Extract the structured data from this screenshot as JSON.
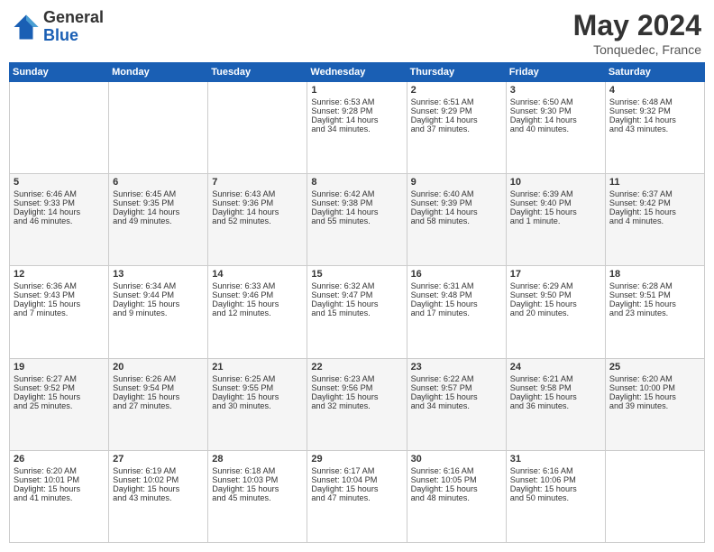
{
  "header": {
    "logo_general": "General",
    "logo_blue": "Blue",
    "month_title": "May 2024",
    "location": "Tonquedec, France"
  },
  "weekdays": [
    "Sunday",
    "Monday",
    "Tuesday",
    "Wednesday",
    "Thursday",
    "Friday",
    "Saturday"
  ],
  "weeks": [
    [
      {
        "day": "",
        "content": ""
      },
      {
        "day": "",
        "content": ""
      },
      {
        "day": "",
        "content": ""
      },
      {
        "day": "1",
        "content": "Sunrise: 6:53 AM\nSunset: 9:28 PM\nDaylight: 14 hours\nand 34 minutes."
      },
      {
        "day": "2",
        "content": "Sunrise: 6:51 AM\nSunset: 9:29 PM\nDaylight: 14 hours\nand 37 minutes."
      },
      {
        "day": "3",
        "content": "Sunrise: 6:50 AM\nSunset: 9:30 PM\nDaylight: 14 hours\nand 40 minutes."
      },
      {
        "day": "4",
        "content": "Sunrise: 6:48 AM\nSunset: 9:32 PM\nDaylight: 14 hours\nand 43 minutes."
      }
    ],
    [
      {
        "day": "5",
        "content": "Sunrise: 6:46 AM\nSunset: 9:33 PM\nDaylight: 14 hours\nand 46 minutes."
      },
      {
        "day": "6",
        "content": "Sunrise: 6:45 AM\nSunset: 9:35 PM\nDaylight: 14 hours\nand 49 minutes."
      },
      {
        "day": "7",
        "content": "Sunrise: 6:43 AM\nSunset: 9:36 PM\nDaylight: 14 hours\nand 52 minutes."
      },
      {
        "day": "8",
        "content": "Sunrise: 6:42 AM\nSunset: 9:38 PM\nDaylight: 14 hours\nand 55 minutes."
      },
      {
        "day": "9",
        "content": "Sunrise: 6:40 AM\nSunset: 9:39 PM\nDaylight: 14 hours\nand 58 minutes."
      },
      {
        "day": "10",
        "content": "Sunrise: 6:39 AM\nSunset: 9:40 PM\nDaylight: 15 hours\nand 1 minute."
      },
      {
        "day": "11",
        "content": "Sunrise: 6:37 AM\nSunset: 9:42 PM\nDaylight: 15 hours\nand 4 minutes."
      }
    ],
    [
      {
        "day": "12",
        "content": "Sunrise: 6:36 AM\nSunset: 9:43 PM\nDaylight: 15 hours\nand 7 minutes."
      },
      {
        "day": "13",
        "content": "Sunrise: 6:34 AM\nSunset: 9:44 PM\nDaylight: 15 hours\nand 9 minutes."
      },
      {
        "day": "14",
        "content": "Sunrise: 6:33 AM\nSunset: 9:46 PM\nDaylight: 15 hours\nand 12 minutes."
      },
      {
        "day": "15",
        "content": "Sunrise: 6:32 AM\nSunset: 9:47 PM\nDaylight: 15 hours\nand 15 minutes."
      },
      {
        "day": "16",
        "content": "Sunrise: 6:31 AM\nSunset: 9:48 PM\nDaylight: 15 hours\nand 17 minutes."
      },
      {
        "day": "17",
        "content": "Sunrise: 6:29 AM\nSunset: 9:50 PM\nDaylight: 15 hours\nand 20 minutes."
      },
      {
        "day": "18",
        "content": "Sunrise: 6:28 AM\nSunset: 9:51 PM\nDaylight: 15 hours\nand 23 minutes."
      }
    ],
    [
      {
        "day": "19",
        "content": "Sunrise: 6:27 AM\nSunset: 9:52 PM\nDaylight: 15 hours\nand 25 minutes."
      },
      {
        "day": "20",
        "content": "Sunrise: 6:26 AM\nSunset: 9:54 PM\nDaylight: 15 hours\nand 27 minutes."
      },
      {
        "day": "21",
        "content": "Sunrise: 6:25 AM\nSunset: 9:55 PM\nDaylight: 15 hours\nand 30 minutes."
      },
      {
        "day": "22",
        "content": "Sunrise: 6:23 AM\nSunset: 9:56 PM\nDaylight: 15 hours\nand 32 minutes."
      },
      {
        "day": "23",
        "content": "Sunrise: 6:22 AM\nSunset: 9:57 PM\nDaylight: 15 hours\nand 34 minutes."
      },
      {
        "day": "24",
        "content": "Sunrise: 6:21 AM\nSunset: 9:58 PM\nDaylight: 15 hours\nand 36 minutes."
      },
      {
        "day": "25",
        "content": "Sunrise: 6:20 AM\nSunset: 10:00 PM\nDaylight: 15 hours\nand 39 minutes."
      }
    ],
    [
      {
        "day": "26",
        "content": "Sunrise: 6:20 AM\nSunset: 10:01 PM\nDaylight: 15 hours\nand 41 minutes."
      },
      {
        "day": "27",
        "content": "Sunrise: 6:19 AM\nSunset: 10:02 PM\nDaylight: 15 hours\nand 43 minutes."
      },
      {
        "day": "28",
        "content": "Sunrise: 6:18 AM\nSunset: 10:03 PM\nDaylight: 15 hours\nand 45 minutes."
      },
      {
        "day": "29",
        "content": "Sunrise: 6:17 AM\nSunset: 10:04 PM\nDaylight: 15 hours\nand 47 minutes."
      },
      {
        "day": "30",
        "content": "Sunrise: 6:16 AM\nSunset: 10:05 PM\nDaylight: 15 hours\nand 48 minutes."
      },
      {
        "day": "31",
        "content": "Sunrise: 6:16 AM\nSunset: 10:06 PM\nDaylight: 15 hours\nand 50 minutes."
      },
      {
        "day": "",
        "content": ""
      }
    ]
  ]
}
